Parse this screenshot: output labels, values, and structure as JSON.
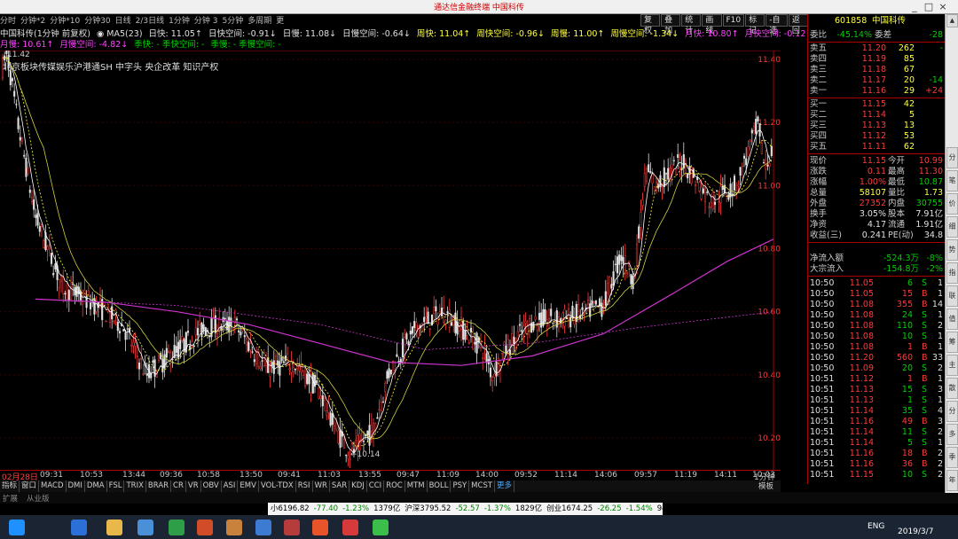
{
  "window": {
    "title": "通达信金融终端   中国科传",
    "controls": [
      "_",
      "□",
      "×"
    ]
  },
  "top_nav": [
    "分时",
    "分钟*2",
    "分钟*10",
    "分钟30",
    "日线",
    "2/3日线",
    "1分钟",
    "分钟 3",
    "5分钟",
    "多周期",
    "更多"
  ],
  "toolbar": [
    "复权",
    "叠加",
    "统计",
    "画线",
    "F10",
    "标记",
    "-自选",
    "返回"
  ],
  "indicator_row1": [
    {
      "text": "中国科传(1分钟 前复权)",
      "color": "#e0e0e0"
    },
    {
      "text": "◉ MA5(23)",
      "color": "#e0e0e0"
    },
    {
      "text": "日快: 11.05↑",
      "color": "#e0e0e0"
    },
    {
      "text": "日快空间: -0.91↓",
      "color": "#e0e0e0"
    },
    {
      "text": "日慢: 11.08↓",
      "color": "#e0e0e0"
    },
    {
      "text": "日慢空间: -0.64↓",
      "color": "#e0e0e0"
    },
    {
      "text": "周快: 11.04↑",
      "color": "#ffff40"
    },
    {
      "text": "周快空间: -0.96↓",
      "color": "#ffff40"
    },
    {
      "text": "周慢: 11.00↑",
      "color": "#ffff40"
    },
    {
      "text": "周慢空间: -1.34↓",
      "color": "#ffff40"
    },
    {
      "text": "月快: 10.80↑",
      "color": "#ff40ff"
    },
    {
      "text": "月快空间: -0.12↓",
      "color": "#ff40ff"
    }
  ],
  "indicator_row2": [
    {
      "text": "月慢: 10.61↑",
      "color": "#ff40ff"
    },
    {
      "text": "月慢空间: -4.82↓",
      "color": "#ff40ff"
    },
    {
      "text": "季快: - 季快空间: -",
      "color": "#00d000"
    },
    {
      "text": "季慢: - 季慢空间: -",
      "color": "#00d000"
    }
  ],
  "concepts": "北京板块传媒娱乐沪港通SH 中字头 央企改革 知识产权",
  "price_high_label": "11.42",
  "price_low_label": "←10.14",
  "price_axis": [
    "11.40",
    "11.20",
    "11.00",
    "10.80",
    "10.60",
    "10.40",
    "10.20"
  ],
  "date_axis": [
    "02月28日",
    "09:31",
    "10:53",
    "13:44",
    "09:36",
    "10:58",
    "13:50",
    "09:41",
    "11:03",
    "13:55",
    "09:47",
    "11:09",
    "14:00",
    "09:52",
    "11:14",
    "14:06",
    "09:57",
    "11:19",
    "14:11",
    "10:03",
    "1分钟"
  ],
  "bottom_tabs": [
    "指标",
    "窗口",
    "MACD",
    "DMI",
    "DMA",
    "FSL",
    "TRIX",
    "BRAR",
    "CR",
    "VR",
    "OBV",
    "ASI",
    "EMV",
    "VOL-TDX",
    "RSI",
    "WR",
    "SAR",
    "KDJ",
    "CCI",
    "ROC",
    "MTM",
    "BOLL",
    "PSY",
    "MCST",
    "更多"
  ],
  "bottom_tab_active": "更多",
  "bottom_tab_right": "模板",
  "bottom_strip": [
    "扩展",
    "从业版",
    "运营"
  ],
  "indices": [
    {
      "text": "小6196.82",
      "color": "#000"
    },
    {
      "text": "-77.40",
      "color": "#008000"
    },
    {
      "text": "-1.23%",
      "color": "#008000"
    },
    {
      "text": "1379亿",
      "color": "#000"
    },
    {
      "text": "沪深3795.52",
      "color": "#000"
    },
    {
      "text": "-52.57",
      "color": "#008000"
    },
    {
      "text": "-1.37%",
      "color": "#008000"
    },
    {
      "text": "1829亿",
      "color": "#000"
    },
    {
      "text": "创业1674.25",
      "color": "#000"
    },
    {
      "text": "-26.25",
      "color": "#008000"
    },
    {
      "text": "-1.54%",
      "color": "#008000"
    },
    {
      "text": "949.5亿",
      "color": "#000"
    }
  ],
  "taskbar": {
    "lang": "ENG",
    "date": "2019/3/7"
  },
  "quote": {
    "code": "601858",
    "name": "中国科传",
    "weibi_label": "委比",
    "weibi": "-45.14%",
    "weicha_label": "委差",
    "weicha": "-28",
    "asks": [
      {
        "label": "卖五",
        "price": "11.20",
        "vol": "262",
        "chg": "-"
      },
      {
        "label": "卖四",
        "price": "11.19",
        "vol": "85",
        "chg": ""
      },
      {
        "label": "卖三",
        "price": "11.18",
        "vol": "67",
        "chg": ""
      },
      {
        "label": "卖二",
        "price": "11.17",
        "vol": "20",
        "chg": "-14"
      },
      {
        "label": "卖一",
        "price": "11.16",
        "vol": "29",
        "chg": "+24"
      }
    ],
    "bids": [
      {
        "label": "买一",
        "price": "11.15",
        "vol": "42"
      },
      {
        "label": "买二",
        "price": "11.14",
        "vol": "5"
      },
      {
        "label": "买三",
        "price": "11.13",
        "vol": "13"
      },
      {
        "label": "买四",
        "price": "11.12",
        "vol": "53"
      },
      {
        "label": "买五",
        "price": "11.11",
        "vol": "62"
      }
    ],
    "stats": [
      {
        "l1": "现价",
        "v1": "11.15",
        "l2": "今开",
        "v2": "10.99",
        "c1": "#ff3b3b",
        "c2": "#ff3b3b"
      },
      {
        "l1": "涨跌",
        "v1": "0.11",
        "l2": "最高",
        "v2": "11.30",
        "c1": "#ff3b3b",
        "c2": "#ff3b3b"
      },
      {
        "l1": "涨幅",
        "v1": "1.00%",
        "l2": "最低",
        "v2": "10.87",
        "c1": "#ff3b3b",
        "c2": "#00d000"
      },
      {
        "l1": "总量",
        "v1": "58107",
        "l2": "量比",
        "v2": "1.73",
        "c1": "#ffff40",
        "c2": "#ffff40"
      },
      {
        "l1": "外盘",
        "v1": "27352",
        "l2": "内盘",
        "v2": "30755",
        "c1": "#ff3b3b",
        "c2": "#00d000"
      },
      {
        "l1": "换手",
        "v1": "3.05%",
        "l2": "股本",
        "v2": "7.91亿",
        "c1": "#e0e0e0",
        "c2": "#e0e0e0"
      },
      {
        "l1": "净资",
        "v1": "4.17",
        "l2": "流通",
        "v2": "1.91亿",
        "c1": "#e0e0e0",
        "c2": "#e0e0e0"
      },
      {
        "l1": "收益(三)",
        "v1": "0.241",
        "l2": "PE(动)",
        "v2": "34.8",
        "c1": "#e0e0e0",
        "c2": "#e0e0e0"
      }
    ],
    "flows": [
      {
        "label": "净流入额",
        "value": "-524.3万",
        "pct": "-8%"
      },
      {
        "label": "大宗流入",
        "value": "-154.8万",
        "pct": "-2%"
      }
    ],
    "ticks": [
      {
        "t": "10:50",
        "p": "11.05",
        "v": "6",
        "s": "S",
        "n": "1"
      },
      {
        "t": "10:50",
        "p": "11.05",
        "v": "15",
        "s": "B",
        "n": "1"
      },
      {
        "t": "10:50",
        "p": "11.08",
        "v": "355",
        "s": "B",
        "n": "14"
      },
      {
        "t": "10:50",
        "p": "11.08",
        "v": "24",
        "s": "S",
        "n": "1"
      },
      {
        "t": "10:50",
        "p": "11.08",
        "v": "110",
        "s": "S",
        "n": "2"
      },
      {
        "t": "10:50",
        "p": "11.08",
        "v": "10",
        "s": "S",
        "n": "1"
      },
      {
        "t": "10:50",
        "p": "11.08",
        "v": "1",
        "s": "B",
        "n": "1"
      },
      {
        "t": "10:50",
        "p": "11.20",
        "v": "560",
        "s": "B",
        "n": "33"
      },
      {
        "t": "10:50",
        "p": "11.09",
        "v": "20",
        "s": "S",
        "n": "2"
      },
      {
        "t": "10:51",
        "p": "11.12",
        "v": "1",
        "s": "B",
        "n": "1"
      },
      {
        "t": "10:51",
        "p": "11.13",
        "v": "15",
        "s": "S",
        "n": "3"
      },
      {
        "t": "10:51",
        "p": "11.13",
        "v": "1",
        "s": "S",
        "n": "1"
      },
      {
        "t": "10:51",
        "p": "11.14",
        "v": "35",
        "s": "S",
        "n": "4"
      },
      {
        "t": "10:51",
        "p": "11.16",
        "v": "49",
        "s": "B",
        "n": "3"
      },
      {
        "t": "10:51",
        "p": "11.14",
        "v": "11",
        "s": "S",
        "n": "2"
      },
      {
        "t": "10:51",
        "p": "11.14",
        "v": "5",
        "s": "S",
        "n": "1"
      },
      {
        "t": "10:51",
        "p": "11.16",
        "v": "18",
        "s": "B",
        "n": "2"
      },
      {
        "t": "10:51",
        "p": "11.16",
        "v": "36",
        "s": "B",
        "n": "2"
      },
      {
        "t": "10:51",
        "p": "11.15",
        "v": "10",
        "s": "S",
        "n": "2"
      }
    ]
  },
  "side_tabs": [
    "分",
    "笔",
    "价",
    "细",
    "势",
    "指",
    "联",
    "值",
    "筹",
    "主",
    "散",
    "分",
    "多",
    "季",
    "年"
  ],
  "colors": {
    "up": "#ff3b3b",
    "down": "#00d000",
    "bg": "#000000",
    "ma_yellow": "#ffff40",
    "ma_white": "#e0e0e0",
    "ma_magenta": "#cc33cc"
  }
}
